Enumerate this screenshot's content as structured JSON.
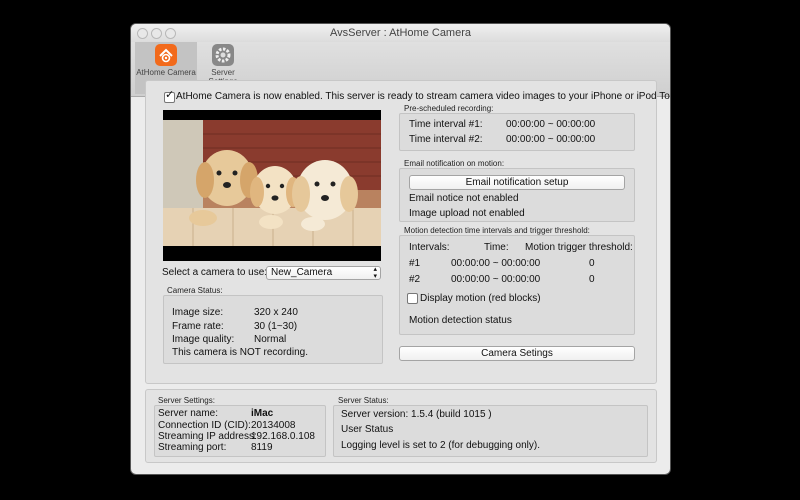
{
  "window": {
    "title": "AvsServer : AtHome Camera"
  },
  "toolbar": {
    "items": [
      {
        "label": "AtHome Camera",
        "icon": "athome-camera-icon"
      },
      {
        "label": "Server Settings",
        "icon": "server-settings-icon"
      }
    ]
  },
  "main": {
    "enable_label": "AtHome Camera is now enabled. This server is ready to stream camera video images to your iPhone or iPod Touch.",
    "enable_checked": true,
    "select_camera_label": "Select a camera to use:",
    "selected_camera": "New_Camera",
    "camera_status": {
      "group_label": "Camera Status:",
      "rows": [
        {
          "label": "Image size:",
          "value": "320 x 240"
        },
        {
          "label": "Frame rate:",
          "value": "30 (1~30)"
        },
        {
          "label": "Image quality:",
          "value": "Normal"
        }
      ],
      "recording_text": "This camera is NOT recording."
    },
    "prescheduled": {
      "group_label": "Pre-scheduled recording:",
      "rows": [
        {
          "label": "Time interval #1:",
          "value": "00:00:00 ~ 00:00:00"
        },
        {
          "label": "Time interval #2:",
          "value": "00:00:00 ~ 00:00:00"
        }
      ]
    },
    "email": {
      "group_label": "Email notification on motion:",
      "button_label": "Email notification setup",
      "notice": "Email notice not enabled",
      "upload": "Image upload not enabled"
    },
    "motion": {
      "group_label": "Motion detection time intervals and trigger threshold:",
      "headers": {
        "intervals": "Intervals:",
        "time": "Time:",
        "threshold": "Motion trigger threshold:"
      },
      "rows": [
        {
          "id": "#1",
          "time": "00:00:00 ~ 00:00:00",
          "threshold": "0"
        },
        {
          "id": "#2",
          "time": "00:00:00 ~ 00:00:00",
          "threshold": "0"
        }
      ],
      "display_label": "Display motion (red blocks)",
      "display_checked": false,
      "status_text": "Motion detection status"
    },
    "camera_settings_button": "Camera Setings"
  },
  "server_settings": {
    "group_label": "Server Settings:",
    "rows": [
      {
        "label": "Server name:",
        "value": "iMac"
      },
      {
        "label": "Connection ID (CID):",
        "value": "20134008"
      },
      {
        "label": "Streaming IP address:",
        "value": "192.168.0.108"
      },
      {
        "label": "Streaming port:",
        "value": "8119"
      }
    ]
  },
  "server_status": {
    "group_label": "Server Status:",
    "version": "Server version: 1.5.4  (build 1015 )",
    "user_status": "User Status",
    "logging": "Logging level is set to 2 (for debugging only)."
  },
  "colors": {
    "accent_orange": "#f26a1b",
    "window_bg": "#ececec",
    "panel_bg": "#dcdcdc"
  }
}
